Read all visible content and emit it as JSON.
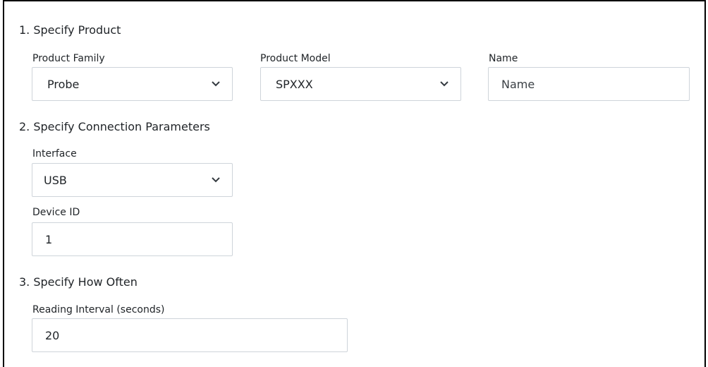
{
  "sections": {
    "product": {
      "title": "1. Specify Product",
      "family": {
        "label": "Product Family",
        "selected": "Probe",
        "icon": "chevron-down-icon"
      },
      "model": {
        "label": "Product Model",
        "selected": "SPXXX",
        "icon": "chevron-down-icon"
      },
      "name": {
        "label": "Name",
        "value": "",
        "placeholder": "Name"
      }
    },
    "connection": {
      "title": "2. Specify Connection Parameters",
      "interface": {
        "label": "Interface",
        "selected": "USB",
        "icon": "chevron-down-icon"
      },
      "device_id": {
        "label": "Device ID",
        "value": "1"
      }
    },
    "frequency": {
      "title": "3. Specify How Often",
      "interval": {
        "label": "Reading Interval (seconds)",
        "value": "20"
      }
    }
  }
}
